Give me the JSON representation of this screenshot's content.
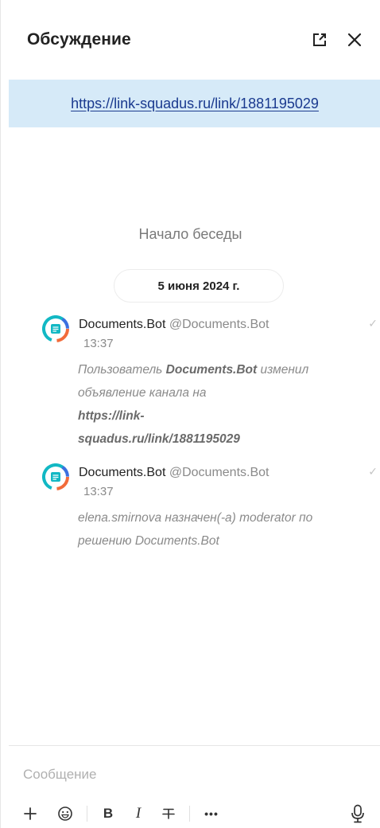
{
  "header": {
    "title": "Обсуждение",
    "open_external_icon": "open-in-new-icon",
    "close_icon": "close-icon"
  },
  "banner": {
    "link": "https://link-squadus.ru/link/1881195029"
  },
  "chat": {
    "start_label": "Начало беседы",
    "date": "5 июня 2024 г.",
    "messages": [
      {
        "author": "Documents.Bot",
        "handle": "@Documents.Bot",
        "time": "13:37",
        "text_prefix": "Пользователь ",
        "text_bold": "Documents.Bot",
        "text_middle": " изменил объявление канала на ",
        "text_link_line1": "https://link-",
        "text_link_line2": "squadus.ru/link/1881195029"
      },
      {
        "author": "Documents.Bot",
        "handle": "@Documents.Bot",
        "time": "13:37",
        "text": "elena.smirnova назначен(-а) moderator по решению Documents.Bot"
      }
    ]
  },
  "composer": {
    "placeholder": "Сообщение",
    "toolbar": {
      "bold_label": "B",
      "italic_label": "I",
      "more_label": "•••"
    }
  },
  "colors": {
    "banner_bg": "#d6eaf8",
    "link": "#1a3a8f",
    "avatar_ring_teal": "#12b8c4",
    "avatar_ring_orange": "#f26b3a",
    "avatar_ring_blue": "#3d6fe0"
  }
}
